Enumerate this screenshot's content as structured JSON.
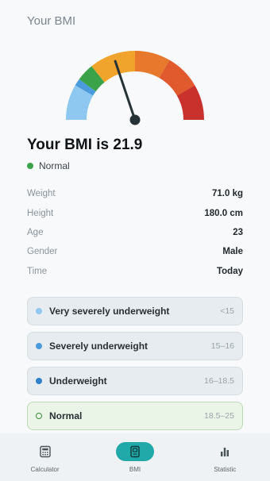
{
  "header": {
    "title": "Your BMI"
  },
  "result": {
    "title": "Your BMI is 21.9",
    "bmi_value": 21.9,
    "status_label": "Normal",
    "status_color": "#3aa34a"
  },
  "gauge": {
    "segment_colors": [
      "#8ec7f0",
      "#4a9bdc",
      "#3aa34a",
      "#f0a42b",
      "#e8782b",
      "#e05a2e",
      "#c9322c"
    ],
    "needle_color": "#263238"
  },
  "details": [
    {
      "key": "Weight",
      "value": "71.0 kg"
    },
    {
      "key": "Height",
      "value": "180.0 cm"
    },
    {
      "key": "Age",
      "value": "23"
    },
    {
      "key": "Gender",
      "value": "Male"
    },
    {
      "key": "Time",
      "value": "Today"
    }
  ],
  "ranges": [
    {
      "label": "Very severely underweight",
      "value": "<15",
      "dot_color": "#8ec7f0"
    },
    {
      "label": "Severely underweight",
      "value": "15–16",
      "dot_color": "#4a9bdc"
    },
    {
      "label": "Underweight",
      "value": "16–18.5",
      "dot_color": "#2f80c9"
    },
    {
      "label": "Normal",
      "value": "18.5–25",
      "dot_color": "#3d8a3a"
    }
  ],
  "nav": [
    {
      "label": "Calculator",
      "icon": "calculator-icon"
    },
    {
      "label": "BMI",
      "icon": "bmi-icon"
    },
    {
      "label": "Statistic",
      "icon": "bar-chart-icon"
    }
  ],
  "accent_color": "#21a8a8"
}
